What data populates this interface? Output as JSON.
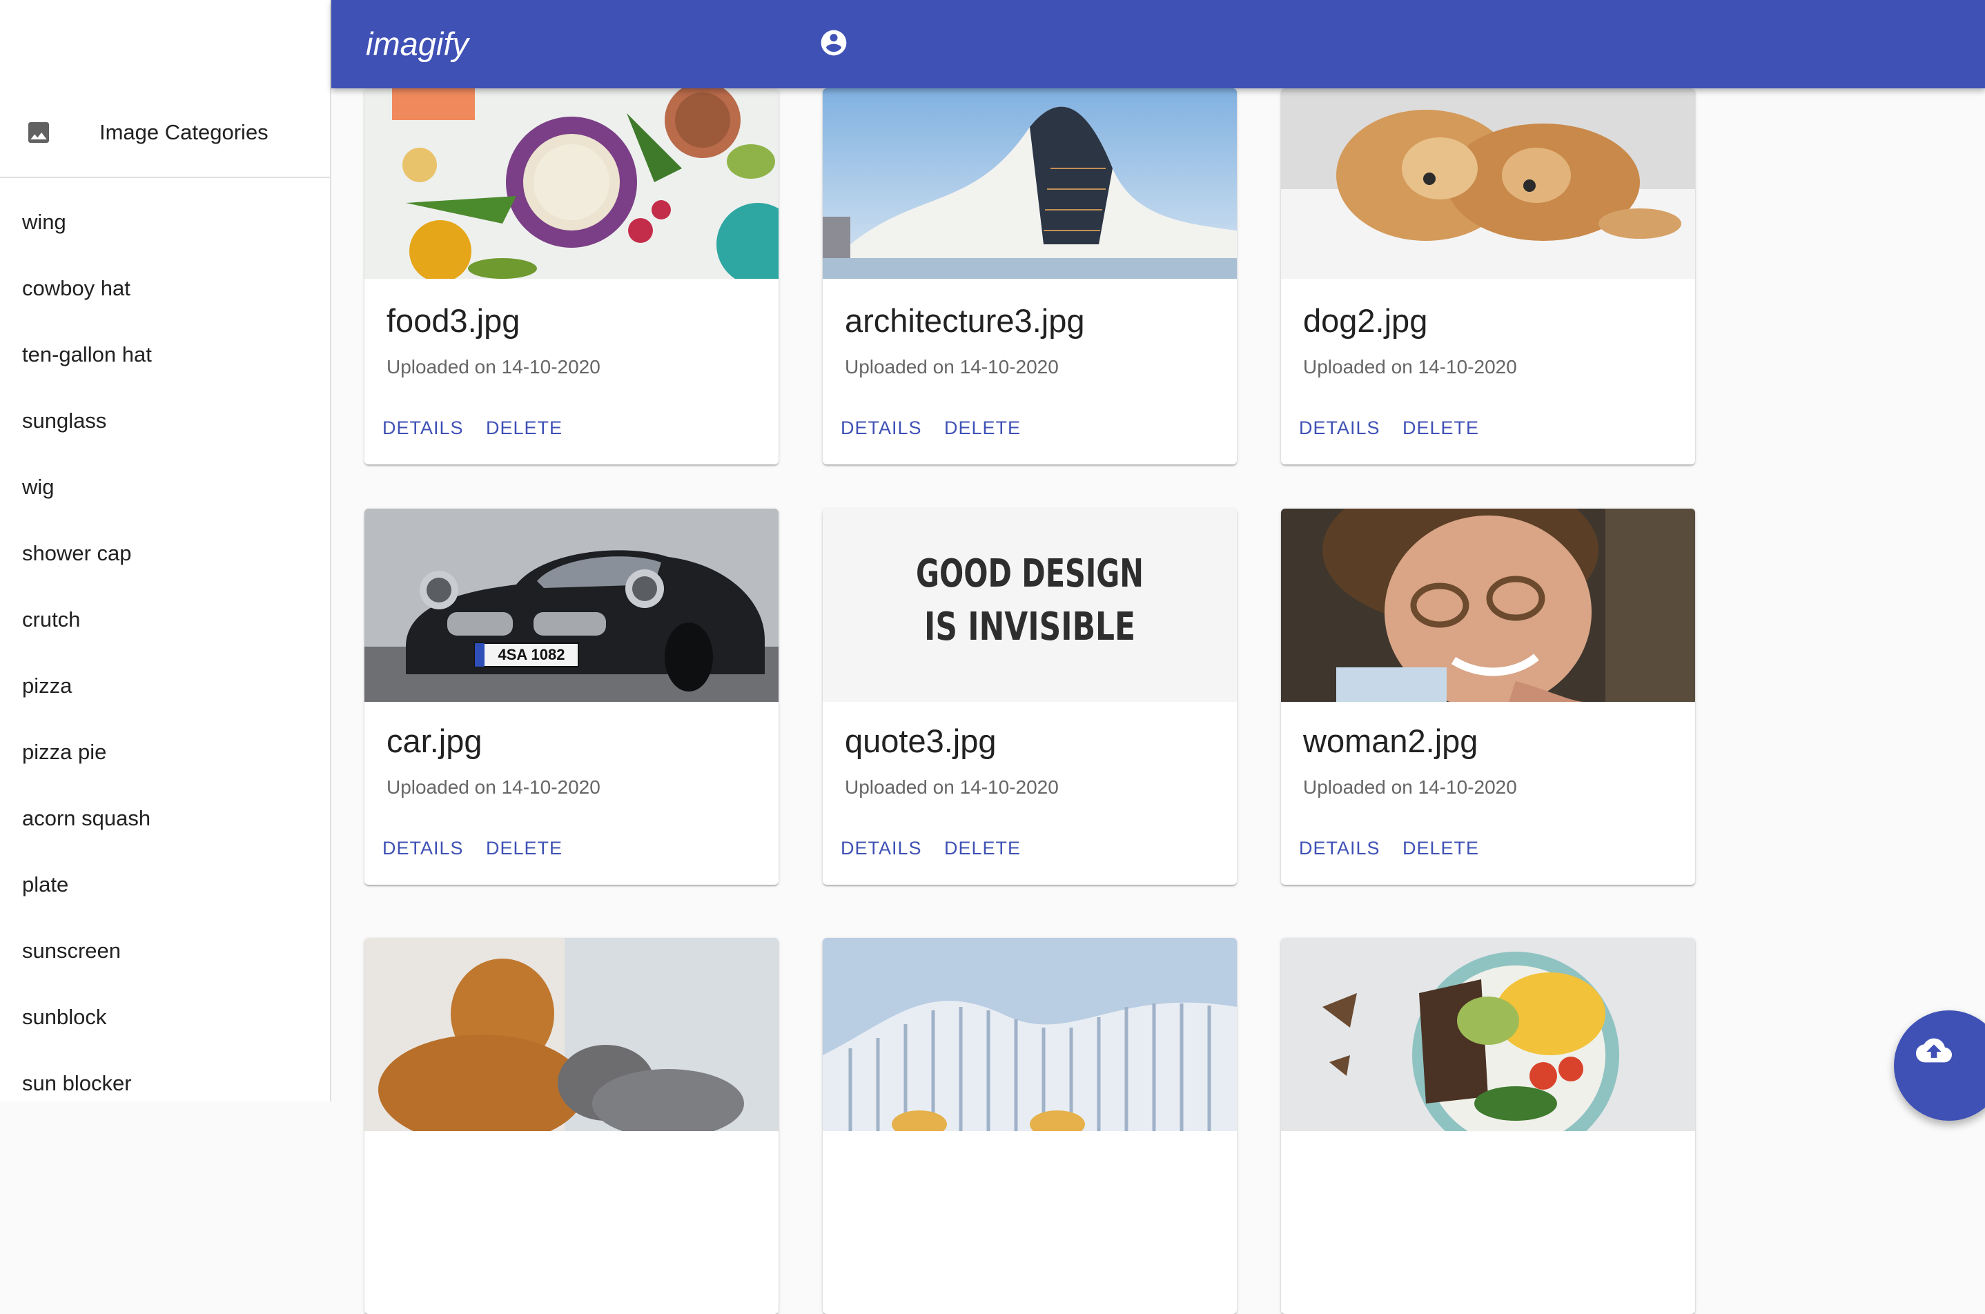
{
  "app": {
    "title": "imagify"
  },
  "icons": {
    "sidebar_header": "image-icon",
    "account": "account-circle-icon",
    "upload": "cloud-upload-icon"
  },
  "colors": {
    "primary": "#3f51b5",
    "background": "#fafafa"
  },
  "sidebar": {
    "header_label": "Image Categories",
    "categories": [
      "wing",
      "cowboy hat",
      "ten-gallon hat",
      "sunglass",
      "wig",
      "shower cap",
      "crutch",
      "pizza",
      "pizza pie",
      "acorn squash",
      "plate",
      "sunscreen",
      "sunblock",
      "sun blocker"
    ]
  },
  "cards": [
    {
      "name": "food3.jpg",
      "date": "Uploaded on 14-10-2020",
      "details_label": "DETAILS",
      "delete_label": "DELETE"
    },
    {
      "name": "architecture3.jpg",
      "date": "Uploaded on 14-10-2020",
      "details_label": "DETAILS",
      "delete_label": "DELETE"
    },
    {
      "name": "dog2.jpg",
      "date": "Uploaded on 14-10-2020",
      "details_label": "DETAILS",
      "delete_label": "DELETE"
    },
    {
      "name": "car.jpg",
      "date": "Uploaded on 14-10-2020",
      "details_label": "DETAILS",
      "delete_label": "DELETE",
      "plate_text": "4SA 1082"
    },
    {
      "name": "quote3.jpg",
      "date": "Uploaded on 14-10-2020",
      "details_label": "DETAILS",
      "delete_label": "DELETE",
      "quote_lines": [
        "GOOD DESIGN",
        "IS INVISIBLE"
      ]
    },
    {
      "name": "woman2.jpg",
      "date": "Uploaded on 14-10-2020",
      "details_label": "DETAILS",
      "delete_label": "DELETE"
    },
    {},
    {},
    {}
  ]
}
